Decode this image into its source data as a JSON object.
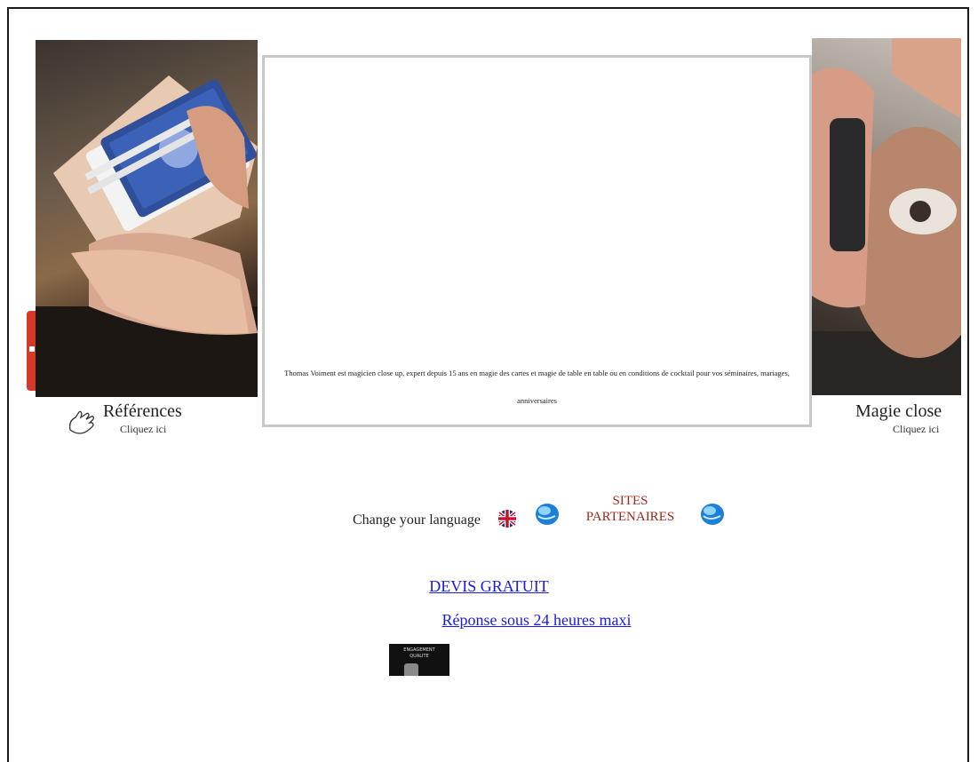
{
  "references": {
    "title": "Références",
    "subtitle": "Cliquez ici"
  },
  "magie_close": {
    "title": "Magie close",
    "subtitle": "Cliquez ici"
  },
  "center": {
    "description": "Thomas Voiment est magicien close up, expert depuis 15 ans en magie des cartes et magie de table en table ou en conditions de cocktail pour vos séminaires, mariages, anniversaires"
  },
  "language": {
    "label": "Change your language",
    "flag_icon": "uk-flag-icon",
    "globe_icon": "globe-icon"
  },
  "partners": {
    "line1": "SITES",
    "line2": "PARTENAIRES"
  },
  "cta": {
    "devis": "DEVIS GRATUIT",
    "reponse": "Réponse sous 24 heures maxi"
  },
  "badge": {
    "line1": "ENGAGEMENT",
    "line2": "QUALITE"
  },
  "colors": {
    "link": "#1a1ae6",
    "partners": "#9b2a1a",
    "side_tab": "#d33a2c",
    "frame_border": "#c8c8c8"
  }
}
